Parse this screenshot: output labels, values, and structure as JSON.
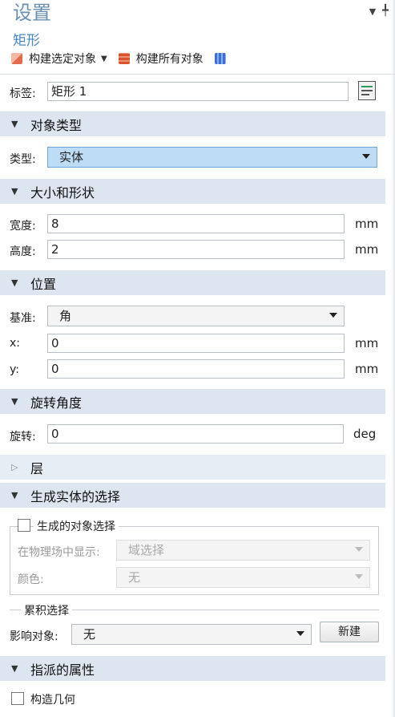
{
  "header": {
    "title": "设置",
    "subtitle": "矩形",
    "pin_icon": "pin-icon",
    "menu_icon": "dropdown-menu-icon"
  },
  "toolbar": {
    "build_selected": "构建选定对象",
    "build_all": "构建所有对象"
  },
  "label_row": {
    "label": "标签:",
    "value": "矩形 1"
  },
  "sections": {
    "object_type": "对象类型",
    "size_shape": "大小和形状",
    "position": "位置",
    "rotation": "旋转角度",
    "layers": "层",
    "selection": "生成实体的选择",
    "assigned": "指派的属性"
  },
  "object_type": {
    "label": "类型:",
    "value": "实体"
  },
  "size": {
    "width_label": "宽度:",
    "width": "8",
    "width_unit": "mm",
    "height_label": "高度:",
    "height": "2",
    "height_unit": "mm"
  },
  "position": {
    "base_label": "基准:",
    "base_value": "角",
    "x_label": "x:",
    "x": "0",
    "x_unit": "mm",
    "y_label": "y:",
    "y": "0",
    "y_unit": "mm"
  },
  "rotation": {
    "label": "旋转:",
    "value": "0",
    "unit": "deg"
  },
  "selection": {
    "checkbox_label": "生成的对象选择",
    "show_label": "在物理场中显示:",
    "show_value": "域选择",
    "color_label": "颜色:",
    "color_value": "无",
    "cumulative_title": "累积选择",
    "affect_label": "影响对象:",
    "affect_value": "无",
    "new_button": "新建"
  },
  "assigned": {
    "checkbox_label": "构造几何"
  },
  "colors": {
    "title": "#6a8fb3",
    "subtitle": "#4a86c5",
    "section_bg": "#dde6f0",
    "select_blue": "#bfdcf5"
  }
}
